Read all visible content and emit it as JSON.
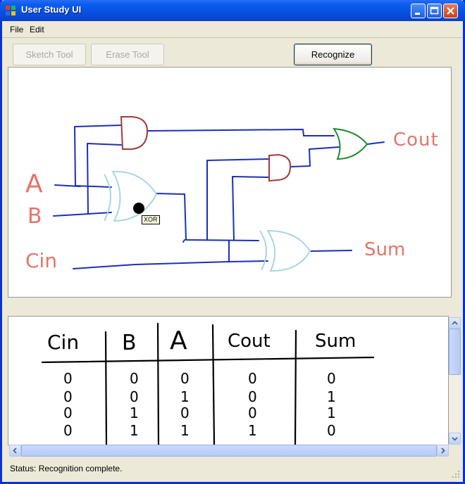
{
  "window": {
    "title": "User Study UI"
  },
  "menu": {
    "items": [
      "File",
      "Edit"
    ]
  },
  "toolbar": {
    "sketch_label": "Sketch Tool",
    "erase_label": "Erase Tool",
    "recognize_label": "Recognize"
  },
  "circuit": {
    "labels": {
      "a": "A",
      "b": "B",
      "cin": "Cin",
      "cout": "Cout",
      "sum": "Sum"
    },
    "tooltip": "XOR"
  },
  "truth_table": {
    "headers": [
      "Cin",
      "B",
      "A",
      "Cout",
      "Sum"
    ],
    "rows": [
      [
        "0",
        "0",
        "0",
        "0",
        "0"
      ],
      [
        "0",
        "0",
        "1",
        "0",
        "1"
      ],
      [
        "0",
        "1",
        "0",
        "0",
        "1"
      ],
      [
        "0",
        "1",
        "1",
        "1",
        "0"
      ]
    ]
  },
  "status": {
    "text": "Status: Recognition complete."
  },
  "colors": {
    "wire": "#1b2fb8",
    "label": "#e2766a",
    "and_gate": "#a33b3b",
    "or_gate": "#1d8a2a",
    "xor_gate": "#a8d6de"
  }
}
